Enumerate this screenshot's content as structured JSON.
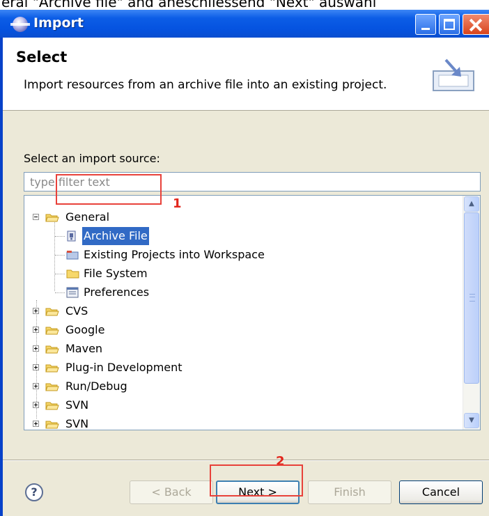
{
  "page_caption": "eral  \"Archive file\"  and aneschliessend  \"Next\"  auswähl",
  "window": {
    "title": "Import"
  },
  "header": {
    "title": "Select",
    "description": "Import resources from an archive file into an existing project."
  },
  "source": {
    "label": "Select an import source:",
    "filter_placeholder": "type filter text"
  },
  "tree": {
    "items": [
      {
        "label": "General",
        "type": "folder",
        "expanded": true
      },
      {
        "label": "Archive File",
        "type": "archive",
        "selected": true
      },
      {
        "label": "Existing Projects into Workspace",
        "type": "project"
      },
      {
        "label": "File System",
        "type": "folder"
      },
      {
        "label": "Preferences",
        "type": "preferences"
      },
      {
        "label": "CVS",
        "type": "folder"
      },
      {
        "label": "Google",
        "type": "folder"
      },
      {
        "label": "Maven",
        "type": "folder"
      },
      {
        "label": "Plug-in Development",
        "type": "folder"
      },
      {
        "label": "Run/Debug",
        "type": "folder"
      },
      {
        "label": "SVN",
        "type": "folder"
      },
      {
        "label": "SVN",
        "type": "folder"
      }
    ]
  },
  "annotations": {
    "step1": "1",
    "step2": "2"
  },
  "buttons": {
    "help": "?",
    "back": "< Back",
    "next": "Next >",
    "finish": "Finish",
    "cancel": "Cancel"
  },
  "colors": {
    "titlebar": "#0553e0",
    "selection": "#316ac5",
    "annotation": "#e8413a"
  }
}
